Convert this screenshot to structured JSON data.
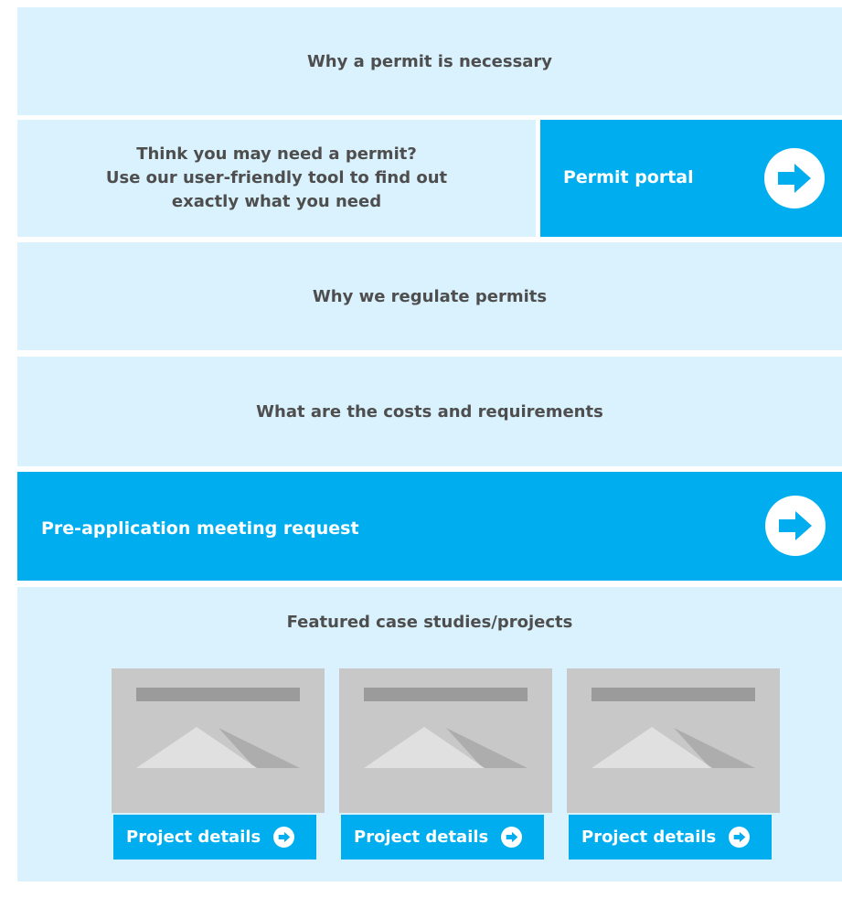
{
  "sections": {
    "why_permit": "Why a permit is necessary",
    "think": {
      "line1": "Think you may need a permit?",
      "line2": "Use our user-friendly tool to find out",
      "line3": "exactly what you need"
    },
    "portal": {
      "label": "Permit portal",
      "icon": "arrow-right-circle-icon"
    },
    "why_regulate": "Why we regulate permits",
    "costs": "What are the costs and requirements",
    "preapp": {
      "label": "Pre-application meeting request",
      "icon": "arrow-right-circle-icon"
    },
    "featured": {
      "title": "Featured case studies/projects",
      "cards": [
        {
          "button_label": "Project details",
          "icon": "arrow-right-circle-icon"
        },
        {
          "button_label": "Project details",
          "icon": "arrow-right-circle-icon"
        },
        {
          "button_label": "Project details",
          "icon": "arrow-right-circle-icon"
        }
      ]
    }
  },
  "colors": {
    "panel_bg": "#d9f2fd",
    "accent_blue": "#00aeef",
    "text": "#4e4e4e",
    "placeholder": "#c8c8c8"
  }
}
